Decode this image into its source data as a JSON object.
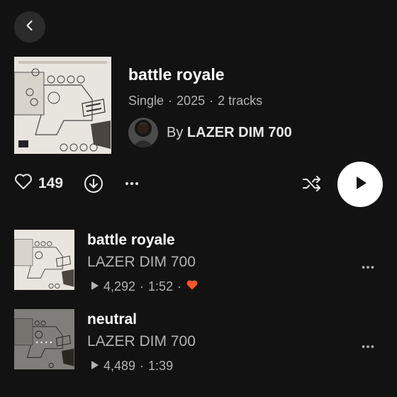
{
  "header": {
    "back_icon": "chevron-left-icon"
  },
  "album": {
    "title": "battle royale",
    "type": "Single",
    "year": "2025",
    "track_count": "2 tracks",
    "separator": "·",
    "artist_prefix": "By",
    "artist_name": "LAZER DIM 700"
  },
  "actions": {
    "like_count": "149",
    "icons": [
      "heart-icon",
      "download-icon",
      "more-icon",
      "shuffle-icon",
      "play-icon"
    ]
  },
  "tracks": [
    {
      "title": "battle royale",
      "artist": "LAZER DIM 700",
      "plays": "4,292",
      "duration": "1:52",
      "liked": true
    },
    {
      "title": "neutral",
      "artist": "LAZER DIM 700",
      "plays": "4,489",
      "duration": "1:39",
      "liked": false,
      "overlay": "...."
    }
  ],
  "colors": {
    "background": "#121212",
    "accent_like": "#ff5722",
    "secondary_text": "#b3b3b3"
  }
}
